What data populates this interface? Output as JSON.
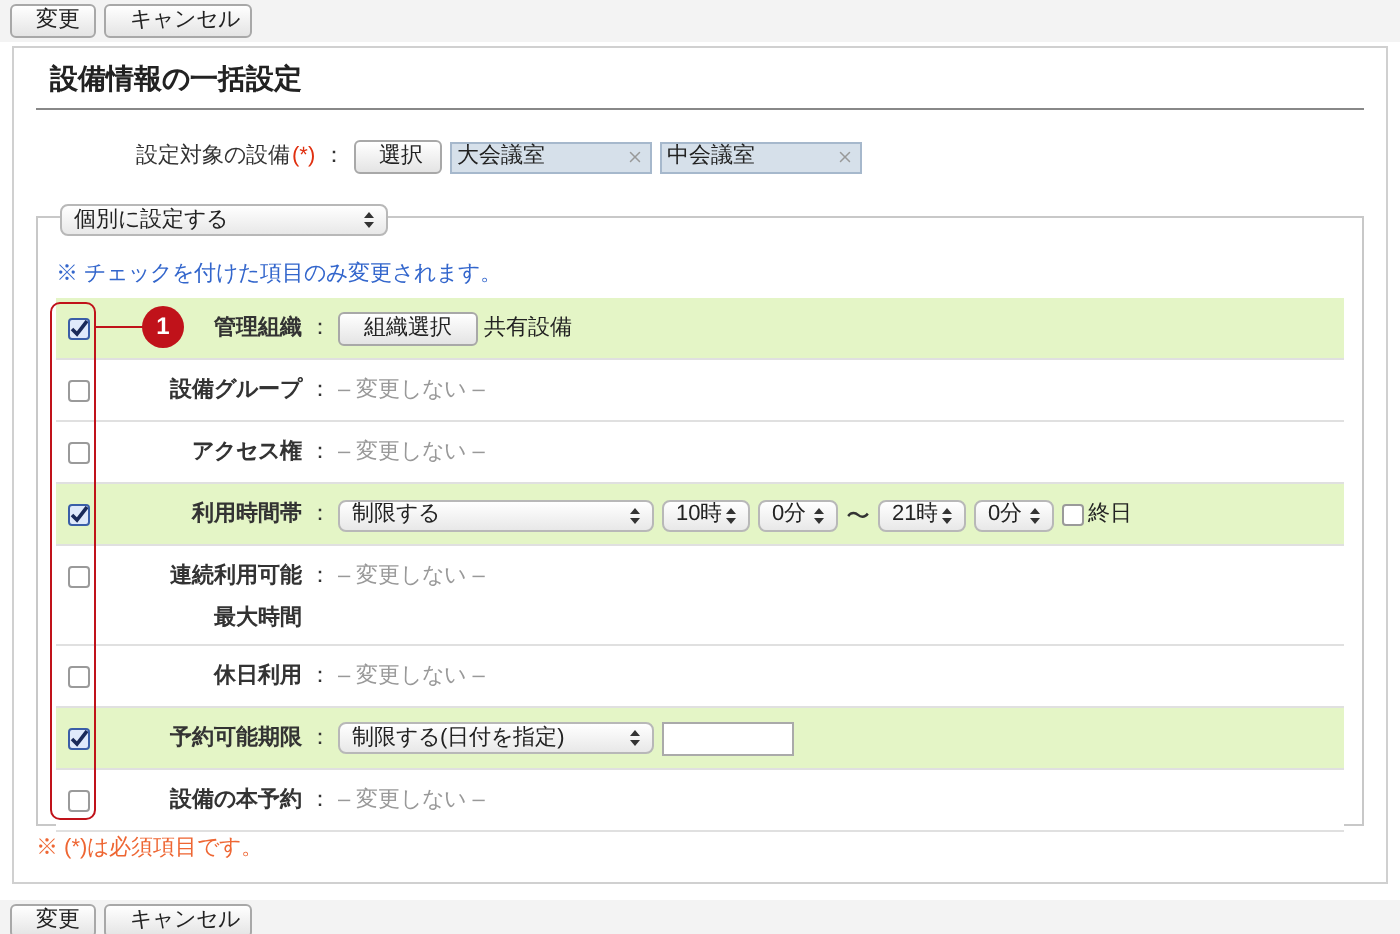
{
  "toolbar_top": {
    "buttons": [
      "変更",
      "キャンセル"
    ]
  },
  "title": "設備情報の一括設定",
  "target": {
    "label": "設定対象の設備",
    "required_mark": "(*)",
    "colon": "：",
    "select_button": "選択",
    "items": [
      "大会議室",
      "中会議室"
    ]
  },
  "mode_select": {
    "value": "個別に設定する"
  },
  "note": "※ チェックを付けた項目のみ変更されます。",
  "callout": "1",
  "rows": [
    {
      "kind": "org",
      "label": [
        "管理組織"
      ],
      "colon": "：",
      "checked": true,
      "button": "組織選択",
      "value": "共有設備"
    },
    {
      "kind": "none",
      "label": [
        "設備グループ"
      ],
      "colon": "：",
      "checked": false,
      "value": "– 変更しない –"
    },
    {
      "kind": "none",
      "label": [
        "アクセス権"
      ],
      "colon": "：",
      "checked": false,
      "value": "– 変更しない –"
    },
    {
      "kind": "time",
      "label": [
        "利用時間帯"
      ],
      "colon": "：",
      "checked": true,
      "select": "制限する",
      "from_hour": "10時",
      "from_min": "0分",
      "tilde": "〜",
      "to_hour": "21時",
      "to_min": "0分",
      "all_day": {
        "label": "終日",
        "checked": false
      }
    },
    {
      "kind": "none",
      "label": [
        "連続利用可能",
        "最大時間"
      ],
      "colon": "：",
      "checked": false,
      "value": "– 変更しない –"
    },
    {
      "kind": "none",
      "label": [
        "休日利用"
      ],
      "colon": "：",
      "checked": false,
      "value": "– 変更しない –"
    },
    {
      "kind": "period",
      "label": [
        "予約可能期限"
      ],
      "colon": "：",
      "checked": true,
      "select": "制限する(日付を指定)",
      "input": ""
    },
    {
      "kind": "none",
      "label": [
        "設備の本予約"
      ],
      "colon": "：",
      "checked": false,
      "value": "– 変更しない –"
    }
  ],
  "required_note": "※ (*)は必須項目です。",
  "toolbar_bottom": {
    "buttons": [
      "変更",
      "キャンセル"
    ]
  }
}
